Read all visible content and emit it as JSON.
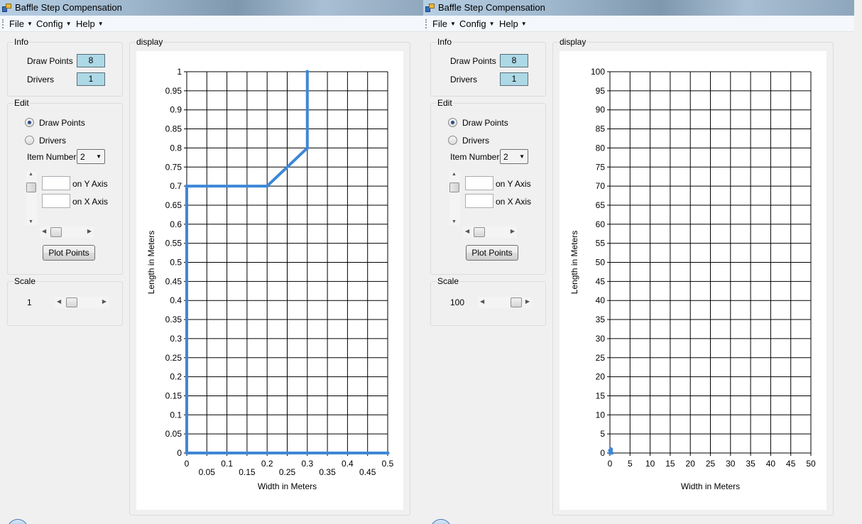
{
  "windows": [
    {
      "title": "Baffle Step Compensation",
      "menu": [
        {
          "label": "File",
          "caret": "▼"
        },
        {
          "label": "Config",
          "caret": "▼"
        },
        {
          "label": "Help",
          "caret": "▼"
        }
      ],
      "info": {
        "title": "Info",
        "draw_points_label": "Draw Points",
        "draw_points_value": "8",
        "drivers_label": "Drivers",
        "drivers_value": "1"
      },
      "edit": {
        "title": "Edit",
        "radio_draw_points": "Draw Points",
        "radio_drivers": "Drivers",
        "selected_radio": "draw_points",
        "item_number_label": "Item Number",
        "item_number_value": "2",
        "y_axis_label": "on Y Axis",
        "y_axis_value": "",
        "x_axis_label": "on X Axis",
        "x_axis_value": "",
        "plot_button": "Plot Points"
      },
      "scale": {
        "title": "Scale",
        "value": "1",
        "slider_level": 0.1
      },
      "display_title": "display",
      "chart_data": {
        "type": "line",
        "xlabel": "Width in Meters",
        "ylabel": "Length in Meters",
        "xlim": [
          0,
          0.5
        ],
        "ylim": [
          0,
          1
        ],
        "xticks": [
          0,
          0.05,
          0.1,
          0.15,
          0.2,
          0.25,
          0.3,
          0.35,
          0.4,
          0.45,
          0.5
        ],
        "xtick_labels": [
          "0",
          "0.05",
          "0.1",
          "0.15",
          "0.2",
          "0.25",
          "0.3",
          "0.35",
          "0.4",
          "0.45",
          "0.5"
        ],
        "yticks": [
          0,
          0.05,
          0.1,
          0.15,
          0.2,
          0.25,
          0.3,
          0.35,
          0.4,
          0.45,
          0.5,
          0.55,
          0.6,
          0.65,
          0.7,
          0.75,
          0.8,
          0.85,
          0.9,
          0.95,
          1
        ],
        "ytick_labels": [
          "0",
          "0.05",
          "0.1",
          "0.15",
          "0.2",
          "0.25",
          "0.3",
          "0.35",
          "0.4",
          "0.45",
          "0.5",
          "0.55",
          "0.6",
          "0.65",
          "0.7",
          "0.75",
          "0.8",
          "0.85",
          "0.9",
          "0.95",
          "1"
        ],
        "grid": true,
        "series": [
          {
            "x": [
              0.5,
              0,
              0,
              0.2,
              0.3,
              0.3
            ],
            "y": [
              0,
              0,
              0.7,
              0.7,
              0.8,
              1
            ],
            "color": "#3f87d6"
          }
        ]
      }
    },
    {
      "title": "Baffle Step Compensation",
      "menu": [
        {
          "label": "File",
          "caret": "▼"
        },
        {
          "label": "Config",
          "caret": "▼"
        },
        {
          "label": "Help",
          "caret": "▼"
        }
      ],
      "info": {
        "title": "Info",
        "draw_points_label": "Draw Points",
        "draw_points_value": "8",
        "drivers_label": "Drivers",
        "drivers_value": "1"
      },
      "edit": {
        "title": "Edit",
        "radio_draw_points": "Draw Points",
        "radio_drivers": "Drivers",
        "selected_radio": "draw_points",
        "item_number_label": "Item Number",
        "item_number_value": "2",
        "y_axis_label": "on Y Axis",
        "y_axis_value": "",
        "x_axis_label": "on X Axis",
        "x_axis_value": "",
        "plot_button": "Plot Points"
      },
      "scale": {
        "title": "Scale",
        "value": "100",
        "slider_level": 0.95
      },
      "display_title": "display",
      "chart_data": {
        "type": "line",
        "xlabel": "Width in Meters",
        "ylabel": "Length in Meters",
        "xlim": [
          0,
          50
        ],
        "ylim": [
          0,
          100
        ],
        "xticks": [
          0,
          5,
          10,
          15,
          20,
          25,
          30,
          35,
          40,
          45,
          50
        ],
        "xtick_labels": [
          "0",
          "5",
          "10",
          "15",
          "20",
          "25",
          "30",
          "35",
          "40",
          "45",
          "50"
        ],
        "yticks": [
          0,
          5,
          10,
          15,
          20,
          25,
          30,
          35,
          40,
          45,
          50,
          55,
          60,
          65,
          70,
          75,
          80,
          85,
          90,
          95,
          100
        ],
        "ytick_labels": [
          "0",
          "5",
          "10",
          "15",
          "20",
          "25",
          "30",
          "35",
          "40",
          "45",
          "50",
          "55",
          "60",
          "65",
          "70",
          "75",
          "80",
          "85",
          "90",
          "95",
          "100"
        ],
        "grid": true,
        "series": [
          {
            "x": [
              0.5,
              0,
              0,
              0.2,
              0.3,
              0.3
            ],
            "y": [
              0,
              0,
              0.7,
              0.7,
              0.8,
              1
            ],
            "color": "#3f87d6"
          }
        ]
      }
    }
  ]
}
